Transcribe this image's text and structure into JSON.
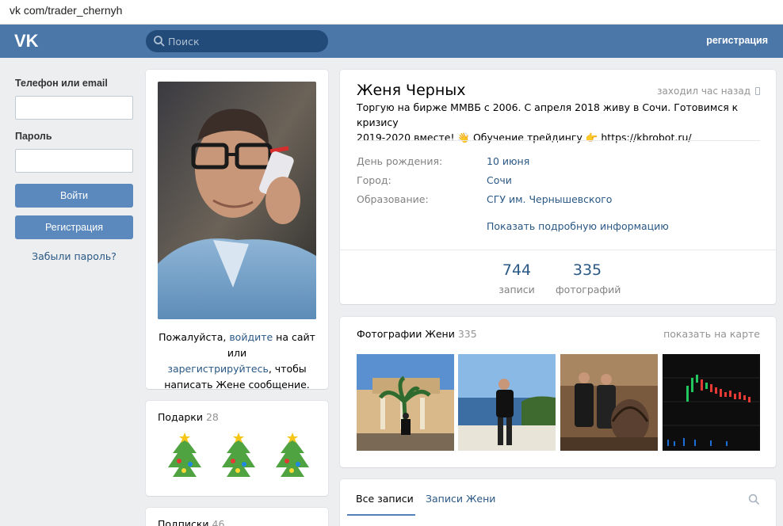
{
  "browser": {
    "url": "vk com/trader_chernyh"
  },
  "header": {
    "search_placeholder": "Поиск",
    "register_link": "регистрация",
    "colors": {
      "bar": "#4a76a8",
      "search": "#224b7a"
    }
  },
  "login": {
    "phone_label": "Телефон или email",
    "password_label": "Пароль",
    "login_button": "Войти",
    "register_button": "Регистрация",
    "forgot_link": "Забыли пароль?"
  },
  "avatar_card": {
    "note_before": "Пожалуйста, ",
    "note_link1": "войдите",
    "note_mid": " на сайт или ",
    "note_link2": "зарегистрируйтесь",
    "note_after": ", чтобы написать Жене сообщение."
  },
  "gifts": {
    "title": "Подарки",
    "count": "28",
    "items": [
      "tree-icon",
      "tree-icon",
      "tree-icon"
    ]
  },
  "subscriptions": {
    "title": "Подписки",
    "count": "46"
  },
  "profile": {
    "name": "Женя Черных",
    "last_seen": "заходил час назад",
    "status_line1": "Торгую на бирже ММВБ с 2006. С апреля 2018 живу в Сочи. Готовимся к кризису",
    "status_line2": "2019-2020 вместе! 👋 Обучение трейдингу 👉 https://kbrobot.ru/",
    "info": [
      {
        "label": "День рождения:",
        "value": "10 июня"
      },
      {
        "label": "Город:",
        "value": "Сочи"
      },
      {
        "label": "Образование:",
        "value": "СГУ им. Чернышевского"
      }
    ],
    "more_link": "Показать подробную информацию",
    "counters": [
      {
        "num": "744",
        "label": "записи"
      },
      {
        "num": "335",
        "label": "фотографий"
      }
    ]
  },
  "photos": {
    "title": "Фотографии Жени",
    "count": "335",
    "map_link": "показать на карте"
  },
  "wall": {
    "tab_all": "Все записи",
    "tab_owner": "Записи Жени"
  }
}
